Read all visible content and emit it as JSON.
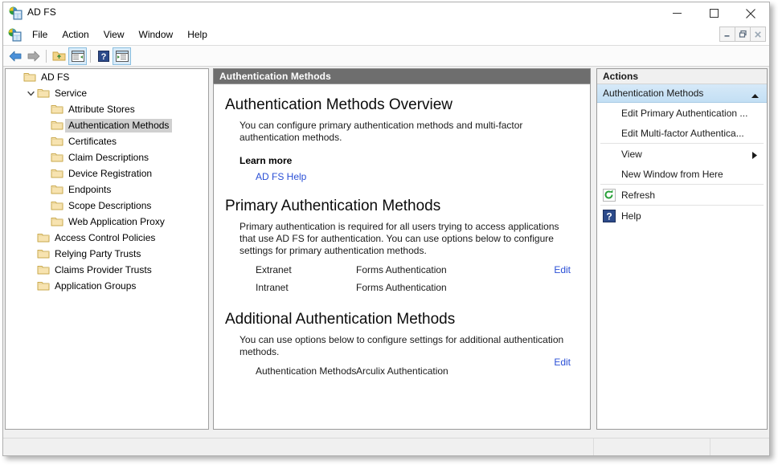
{
  "window": {
    "title": "AD FS",
    "icon": "adfs-app-icon",
    "controls": {
      "minimize": "minimize-icon",
      "maximize": "maximize-icon",
      "close": "close-icon"
    },
    "mdi_controls": {
      "minimize": "mdi-minimize-icon",
      "restore": "mdi-restore-icon",
      "close": "mdi-close-icon"
    }
  },
  "menubar": {
    "icon": "adfs-console-icon",
    "items": [
      {
        "label": "File"
      },
      {
        "label": "Action"
      },
      {
        "label": "View"
      },
      {
        "label": "Window"
      },
      {
        "label": "Help"
      }
    ]
  },
  "toolbar": {
    "buttons": [
      {
        "name": "back-icon",
        "active": false
      },
      {
        "name": "forward-icon",
        "active": false
      },
      {
        "name": "up-folder-icon",
        "active": false
      },
      {
        "name": "show-hide-console-tree-icon",
        "active": true
      },
      {
        "name": "help-icon",
        "active": false
      },
      {
        "name": "show-hide-action-pane-icon",
        "active": true
      }
    ]
  },
  "tree": {
    "nodes": [
      {
        "label": "AD FS",
        "depth": 0,
        "twisty": "none",
        "icon": "folder-icon",
        "selected": false
      },
      {
        "label": "Service",
        "depth": 1,
        "twisty": "expanded",
        "icon": "folder-icon",
        "selected": false
      },
      {
        "label": "Attribute Stores",
        "depth": 2,
        "twisty": "none",
        "icon": "folder-icon",
        "selected": false
      },
      {
        "label": "Authentication Methods",
        "depth": 2,
        "twisty": "none",
        "icon": "folder-icon",
        "selected": true
      },
      {
        "label": "Certificates",
        "depth": 2,
        "twisty": "none",
        "icon": "folder-icon",
        "selected": false
      },
      {
        "label": "Claim Descriptions",
        "depth": 2,
        "twisty": "none",
        "icon": "folder-icon",
        "selected": false
      },
      {
        "label": "Device Registration",
        "depth": 2,
        "twisty": "none",
        "icon": "folder-icon",
        "selected": false
      },
      {
        "label": "Endpoints",
        "depth": 2,
        "twisty": "none",
        "icon": "folder-icon",
        "selected": false
      },
      {
        "label": "Scope Descriptions",
        "depth": 2,
        "twisty": "none",
        "icon": "folder-icon",
        "selected": false
      },
      {
        "label": "Web Application Proxy",
        "depth": 2,
        "twisty": "none",
        "icon": "folder-icon",
        "selected": false
      },
      {
        "label": "Access Control Policies",
        "depth": 1,
        "twisty": "none",
        "icon": "folder-icon",
        "selected": false
      },
      {
        "label": "Relying Party Trusts",
        "depth": 1,
        "twisty": "none",
        "icon": "folder-icon",
        "selected": false
      },
      {
        "label": "Claims Provider Trusts",
        "depth": 1,
        "twisty": "none",
        "icon": "folder-icon",
        "selected": false
      },
      {
        "label": "Application Groups",
        "depth": 1,
        "twisty": "none",
        "icon": "folder-icon",
        "selected": false
      }
    ]
  },
  "content": {
    "header": "Authentication Methods",
    "overview": {
      "title": "Authentication Methods Overview",
      "description": "You can configure primary authentication methods and multi-factor authentication methods.",
      "learn_more_label": "Learn more",
      "help_link": "AD FS Help"
    },
    "primary": {
      "title": "Primary Authentication Methods",
      "description": "Primary authentication is required for all users trying to access applications that use AD FS for authentication. You can use options below to configure settings for primary authentication methods.",
      "rows": [
        {
          "name": "Extranet",
          "value": "Forms Authentication",
          "edit": "Edit"
        },
        {
          "name": "Intranet",
          "value": "Forms Authentication",
          "edit": ""
        }
      ]
    },
    "additional": {
      "title": "Additional Authentication Methods",
      "description": "You can use options below to configure settings for additional authentication methods.",
      "rows": [
        {
          "name": "Authentication Methods",
          "value": "Arculix Authentication",
          "edit": "Edit"
        }
      ]
    }
  },
  "actions": {
    "header": "Actions",
    "group": {
      "label": "Authentication Methods",
      "collapse_icon": "chevron-up-icon"
    },
    "items": [
      {
        "label": "Edit Primary Authentication ...",
        "icon": "",
        "submenu": false,
        "sep_after": false
      },
      {
        "label": "Edit Multi-factor Authentica...",
        "icon": "",
        "submenu": false,
        "sep_after": true
      },
      {
        "label": "View",
        "icon": "",
        "submenu": true,
        "sep_after": false
      },
      {
        "label": "New Window from Here",
        "icon": "",
        "submenu": false,
        "sep_after": true
      },
      {
        "label": "Refresh",
        "icon": "refresh-icon",
        "submenu": false,
        "sep_after": true
      },
      {
        "label": "Help",
        "icon": "help-icon",
        "submenu": false,
        "sep_after": false
      }
    ]
  },
  "statusbar": {
    "cells": [
      "",
      "",
      ""
    ]
  },
  "colors": {
    "header_bar": "#6e6e6e",
    "actions_group": "#c8e2f5",
    "link": "#2a4fd6",
    "tree_selected": "#d0d0d0",
    "toolbar_active": "#d9ebf9"
  }
}
